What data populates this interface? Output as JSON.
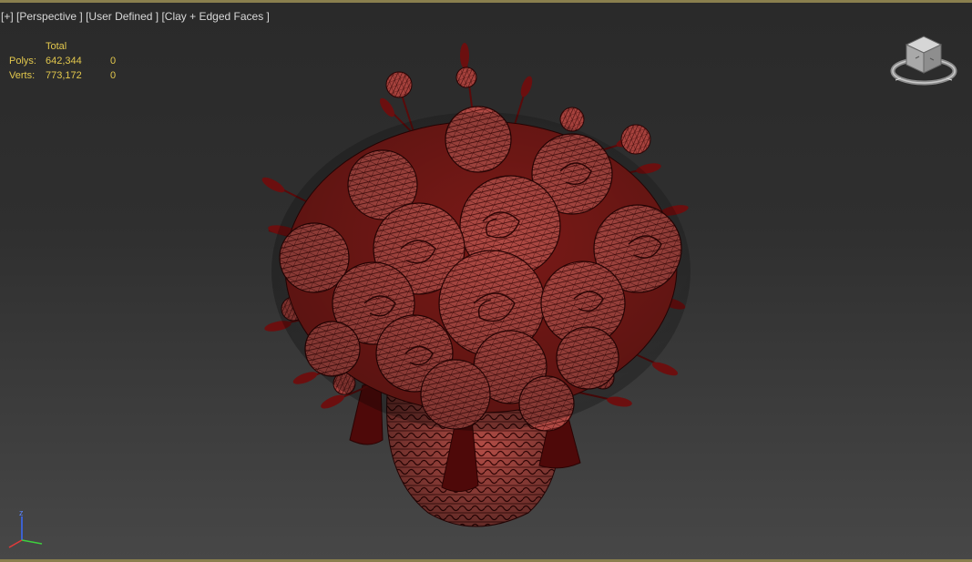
{
  "viewport": {
    "label_plus": "[+]",
    "label_view": "[Perspective ]",
    "label_camera": "[User Defined ]",
    "label_shading": "[Clay + Edged Faces ]"
  },
  "stats": {
    "header": "Total",
    "rows": [
      {
        "label": "Polys:",
        "total": "642,344",
        "selected": "0"
      },
      {
        "label": "Verts:",
        "total": "773,172",
        "selected": "0"
      }
    ]
  },
  "viewcube": {
    "icon": "viewcube-icon"
  },
  "axis_tripod": {
    "z_label": "z",
    "icon": "axis-tripod-icon"
  },
  "model": {
    "description_icon": "flower-vase-mesh",
    "colors": {
      "clay": "#b8514a",
      "edge": "#3a0606",
      "dark": "#4a0808"
    }
  },
  "colors": {
    "frame_border": "#8a7f4e",
    "stats_text": "#e3c84d",
    "label_text": "#d8d8d8"
  }
}
